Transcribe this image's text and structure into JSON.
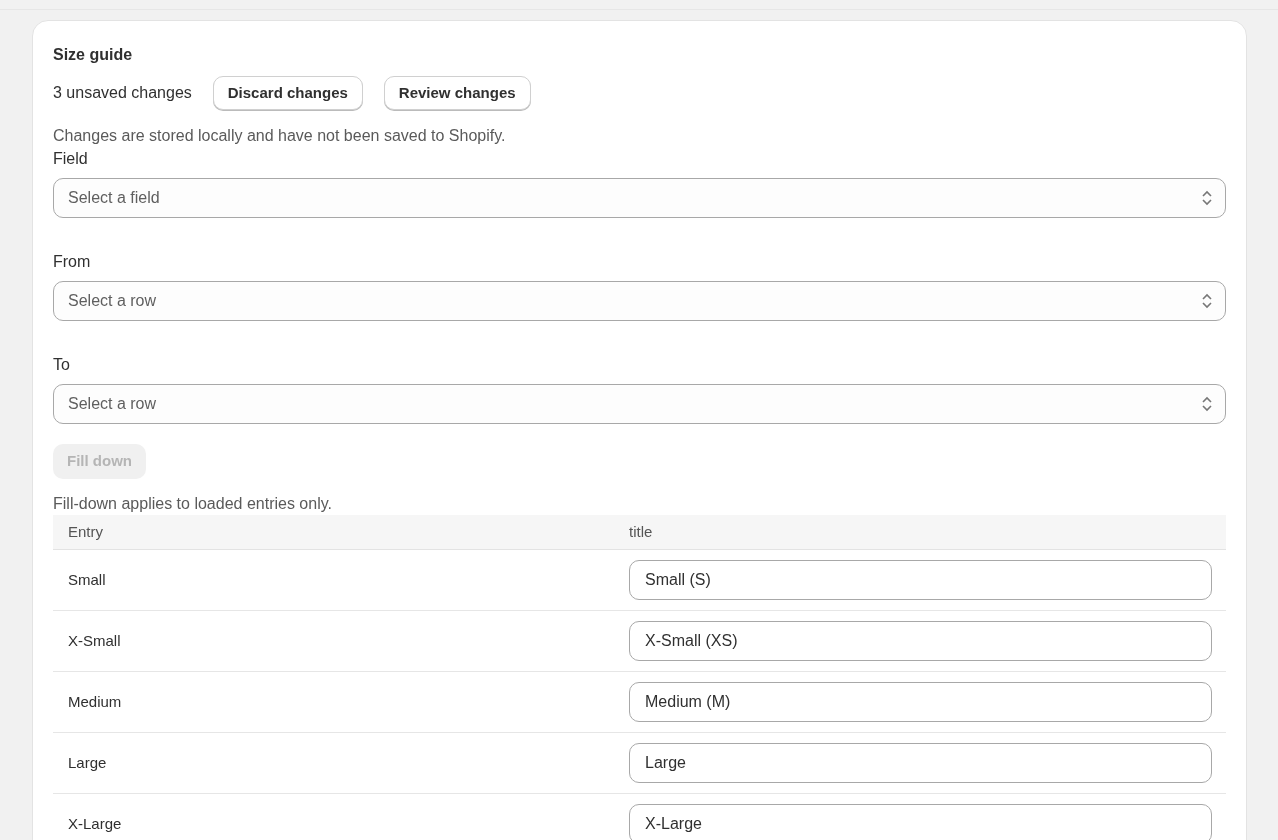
{
  "card": {
    "title": "Size guide",
    "unsaved": "3 unsaved changes",
    "actions": [
      {
        "label": "Discard changes"
      },
      {
        "label": "Review changes"
      }
    ],
    "note": "Changes are stored locally and have not been saved to Shopify.",
    "selects": [
      {
        "label": "Field",
        "placeholder": "Select a field"
      },
      {
        "label": "From",
        "placeholder": "Select a row"
      },
      {
        "label": "To",
        "placeholder": "Select a row"
      }
    ],
    "fill_button": {
      "label": "Fill down",
      "disabled": true
    },
    "hint": "Fill-down applies to loaded entries only.",
    "table": {
      "columns": [
        "Entry",
        "title"
      ],
      "rows": [
        {
          "entry": "Small",
          "value": "Small (S)"
        },
        {
          "entry": "X-Small",
          "value": "X-Small (XS)"
        },
        {
          "entry": "Medium",
          "value": "Medium (M)"
        },
        {
          "entry": "Large",
          "value": "Large"
        },
        {
          "entry": "X-Large",
          "value": "X-Large"
        }
      ]
    }
  }
}
